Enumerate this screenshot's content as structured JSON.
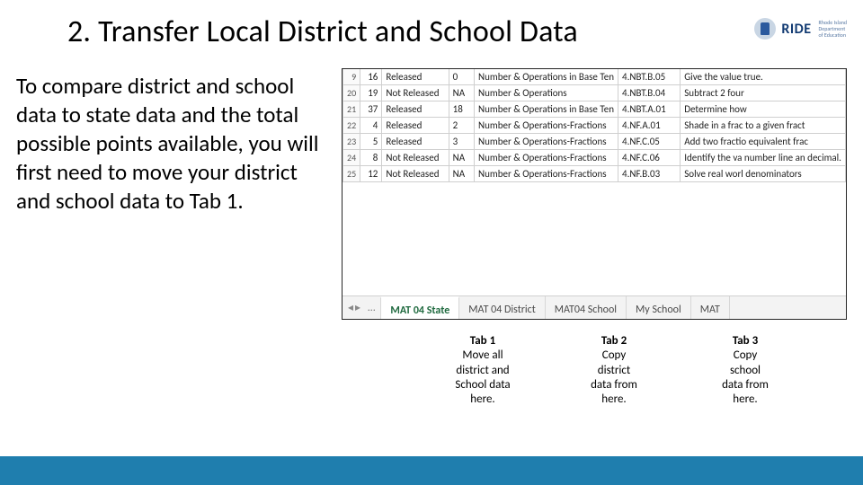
{
  "title": "2. Transfer Local District and School Data",
  "logo": {
    "brand": "RIDE",
    "sub1": "Rhode Island",
    "sub2": "Department",
    "sub3": "of Education"
  },
  "body": "To compare district and school data to state data and the total possible points available, you will first need to move your district and school data to Tab 1.",
  "tabs": {
    "ellipsis": "…",
    "items": [
      "MAT 04 State",
      "MAT 04 District",
      "MAT04 School",
      "My School",
      "MAT"
    ]
  },
  "callouts": [
    {
      "title": "Tab 1",
      "line1": "Move all",
      "line2": "district and",
      "line3": "School data",
      "line4": "here."
    },
    {
      "title": "Tab 2",
      "line1": "Copy",
      "line2": "district",
      "line3": "data from",
      "line4": "here."
    },
    {
      "title": "Tab 3",
      "line1": "Copy",
      "line2": "school",
      "line3": "data from",
      "line4": "here."
    }
  ],
  "chart_data": {
    "type": "table",
    "columns": [
      "row_marker",
      "item",
      "status",
      "points",
      "domain",
      "standard",
      "description"
    ],
    "rows": [
      {
        "row_marker": "9",
        "item": "16",
        "status": "Released",
        "points": "0",
        "domain": "Number & Operations in Base Ten",
        "standard": "4.NBT.B.05",
        "description": "Give the value true."
      },
      {
        "row_marker": "20",
        "item": "19",
        "status": "Not Released",
        "points": "NA",
        "domain": "Number & Operations",
        "standard": "4.NBT.B.04",
        "description": "Subtract 2 four"
      },
      {
        "row_marker": "21",
        "item": "37",
        "status": "Released",
        "points": "18",
        "domain": "Number & Operations in Base Ten",
        "standard": "4.NBT.A.01",
        "description": "Determine how"
      },
      {
        "row_marker": "22",
        "item": "4",
        "status": "Released",
        "points": "2",
        "domain": "Number & Operations-Fractions",
        "standard": "4.NF.A.01",
        "description": "Shade in a frac to a given fract"
      },
      {
        "row_marker": "23",
        "item": "5",
        "status": "Released",
        "points": "3",
        "domain": "Number & Operations-Fractions",
        "standard": "4.NF.C.05",
        "description": "Add two fractio equivalent frac"
      },
      {
        "row_marker": "24",
        "item": "8",
        "status": "Not Released",
        "points": "NA",
        "domain": "Number & Operations-Fractions",
        "standard": "4.NF.C.06",
        "description": "Identify the va number line an decimal."
      },
      {
        "row_marker": "25",
        "item": "12",
        "status": "Not Released",
        "points": "NA",
        "domain": "Number & Operations-Fractions",
        "standard": "4.NF.B.03",
        "description": "Solve real worl denominators"
      }
    ]
  }
}
